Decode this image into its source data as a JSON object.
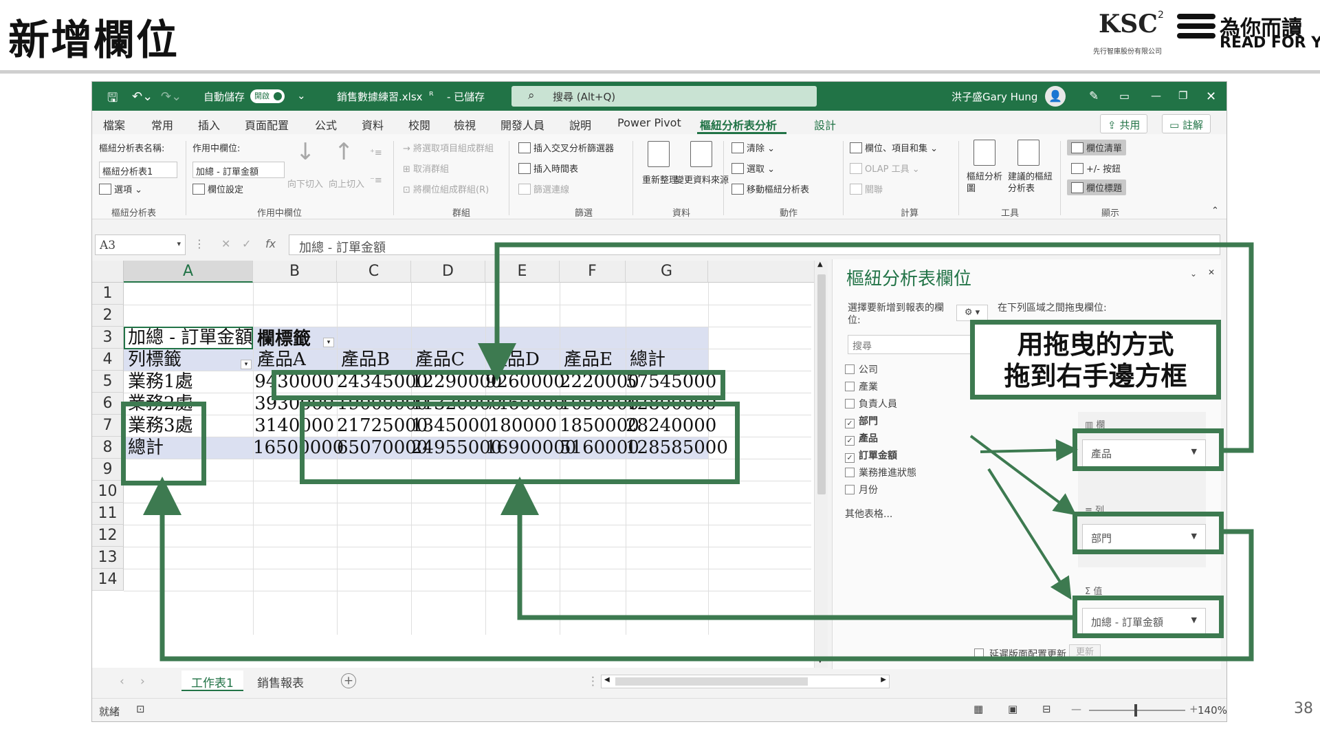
{
  "slide": {
    "title": "新增欄位",
    "page_number": "38",
    "logo_ksc_text": "KSC",
    "logo_ksc_sup": "2",
    "logo_ksc_sub": "先行智庫股份有限公司",
    "logo_rfy_cn": "為你而讀",
    "logo_rfy_en": "READ FOR YOU",
    "callout_line1": "用拖曳的方式",
    "callout_line2": "拖到右手邊方框",
    "annotation_color": "#3d7a50"
  },
  "titlebar": {
    "autosave_label": "自動儲存",
    "autosave_state": "開啟",
    "filename": "銷售數據練習.xlsx",
    "saved_status": "- 已儲存",
    "search_placeholder": "搜尋 (Alt+Q)",
    "user_name": "洪子盛Gary Hung",
    "accent_color": "#217346"
  },
  "tabs": [
    "檔案",
    "常用",
    "插入",
    "頁面配置",
    "公式",
    "資料",
    "校閱",
    "檢視",
    "開發人員",
    "說明",
    "Power Pivot",
    "樞紐分析表分析",
    "設計"
  ],
  "share_label": "共用",
  "comment_label": "註解",
  "ribbon": {
    "pivot_name_label": "樞紐分析表名稱:",
    "pivot_name_value": "樞紐分析表1",
    "options_label": "選項",
    "group_pivot": "樞紐分析表",
    "active_field_label": "作用中欄位:",
    "active_field_value": "加總 - 訂單金額",
    "field_settings": "欄位設定",
    "drill_down": "向下切入",
    "drill_up": "向上切入",
    "group_active_field": "作用中欄位",
    "group_selection": "將選取項目組成群組",
    "ungroup": "取消群組",
    "group_field": "將欄位組成群組(R)",
    "group_group": "群組",
    "insert_slicer": "插入交叉分析篩選器",
    "insert_timeline": "插入時間表",
    "filter_connections": "篩選連線",
    "group_filter": "篩選",
    "refresh": "重新整理",
    "change_source": "變更資料來源",
    "group_data": "資料",
    "clear": "清除",
    "select": "選取",
    "move_pivot": "移動樞紐分析表",
    "group_actions": "動作",
    "fields_items_sets": "欄位、項目和集",
    "olap_tools": "OLAP 工具",
    "relationships": "關聯",
    "group_calc": "計算",
    "pivot_chart": "樞紐分析圖",
    "recommended_pivot": "建議的樞紐分析表",
    "group_tools": "工具",
    "field_list": "欄位清單",
    "buttons": "+/- 按鈕",
    "field_headers": "欄位標題",
    "group_show": "顯示"
  },
  "formula_bar": {
    "name_box": "A3",
    "formula": "加總 - 訂單金額"
  },
  "sheet": {
    "columns": [
      "A",
      "B",
      "C",
      "D",
      "E",
      "F",
      "G"
    ],
    "rows": [
      "1",
      "2",
      "3",
      "4",
      "5",
      "6",
      "7",
      "8",
      "9",
      "10",
      "11",
      "12",
      "13",
      "14"
    ],
    "pivot_value_label": "加總 - 訂單金額",
    "col_labels_header": "欄標籤",
    "row_labels_header": "列標籤",
    "products": [
      "產品A",
      "產品B",
      "產品C",
      "產品D",
      "產品E"
    ],
    "grand_total_col": "總計",
    "grand_total_row": "總計",
    "data_rows": [
      {
        "label": "業務1處",
        "values": [
          "9430000",
          "24345000",
          "12290000",
          "9260000",
          "2220000",
          "57545000"
        ]
      },
      {
        "label": "業務2處",
        "values": [
          "3930000",
          "19000000",
          "11320000",
          "7460000",
          "1090000",
          "42800000"
        ]
      },
      {
        "label": "業務3處",
        "values": [
          "3140000",
          "21725000",
          "1345000",
          "180000",
          "1850000",
          "28240000"
        ]
      }
    ],
    "total_values": [
      "16500000",
      "65070000",
      "24955000",
      "16900000",
      "5160000",
      "128585000"
    ]
  },
  "pivot_panel": {
    "title": "樞紐分析表欄位",
    "choose_fields": "選擇要新增到報表的欄位:",
    "drag_hint": "在下列區域之間拖曳欄位:",
    "search_placeholder": "搜尋",
    "fields": [
      {
        "name": "公司",
        "checked": false
      },
      {
        "name": "產業",
        "checked": false
      },
      {
        "name": "負責人員",
        "checked": false
      },
      {
        "name": "部門",
        "checked": true
      },
      {
        "name": "產品",
        "checked": true
      },
      {
        "name": "訂單金額",
        "checked": true
      },
      {
        "name": "業務推進狀態",
        "checked": false
      },
      {
        "name": "月份",
        "checked": false
      }
    ],
    "more_tables": "其他表格...",
    "columns_area_label": "欄",
    "rows_area_label": "列",
    "values_area_label": "Σ 值",
    "columns_value": "產品",
    "rows_value": "部門",
    "values_value": "加總 - 訂單金額",
    "defer_update": "延遲版面配置更新",
    "update_button": "更新"
  },
  "sheet_tabs": [
    "工作表1",
    "銷售報表"
  ],
  "status": {
    "ready": "就緒",
    "zoom": "140%"
  }
}
